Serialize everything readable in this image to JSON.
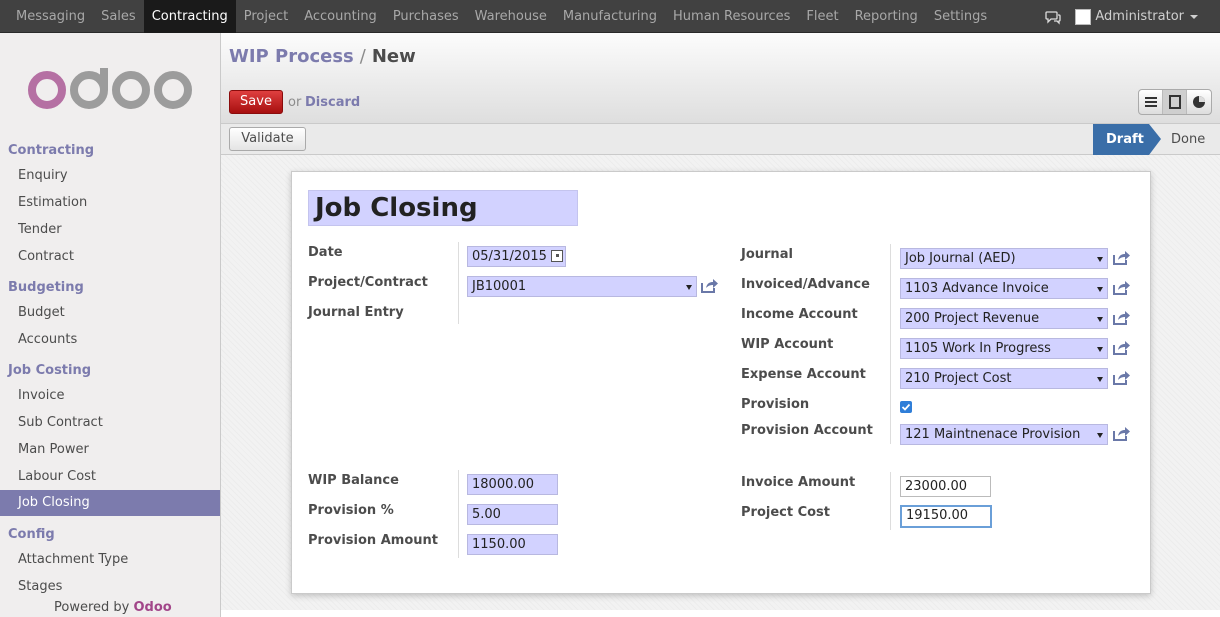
{
  "topmenu": [
    "Messaging",
    "Sales",
    "Contracting",
    "Project",
    "Accounting",
    "Purchases",
    "Warehouse",
    "Manufacturing",
    "Human Resources",
    "Fleet",
    "Reporting",
    "Settings"
  ],
  "user": {
    "name": "Administrator"
  },
  "logo": {
    "text": "odoo"
  },
  "sidebar": {
    "sections": [
      {
        "title": "Contracting",
        "items": [
          "Enquiry",
          "Estimation",
          "Tender",
          "Contract"
        ]
      },
      {
        "title": "Budgeting",
        "items": [
          "Budget",
          "Accounts"
        ]
      },
      {
        "title": "Job Costing",
        "items": [
          "Invoice",
          "Sub Contract",
          "Man Power",
          "Labour Cost",
          "Job Closing"
        ]
      },
      {
        "title": "Config",
        "items": [
          "Attachment Type",
          "Stages"
        ]
      }
    ],
    "active_item": "Job Closing",
    "powered_by": {
      "prefix": "Powered by",
      "brand": "Odoo"
    }
  },
  "breadcrumb": {
    "parent": "WIP Process",
    "separator": "/",
    "current": "New"
  },
  "buttons": {
    "save": "Save",
    "or": "or",
    "discard": "Discard",
    "validate": "Validate"
  },
  "statusbar": {
    "states": [
      "Draft",
      "Done"
    ],
    "active": "Draft"
  },
  "form": {
    "title": "Job Closing",
    "left": [
      {
        "label": "Date",
        "value": "05/31/2015",
        "kind": "date"
      },
      {
        "label": "Project/Contract",
        "value": "JB10001",
        "kind": "select"
      },
      {
        "label": "Journal Entry",
        "value": "",
        "kind": "empty"
      }
    ],
    "right": [
      {
        "label": "Journal",
        "value": "Job Journal (AED)"
      },
      {
        "label": "Invoiced/Advance",
        "value": "1103 Advance Invoice"
      },
      {
        "label": "Income Account",
        "value": "200 Project Revenue"
      },
      {
        "label": "WIP Account",
        "value": "1105 Work In Progress"
      },
      {
        "label": "Expense Account",
        "value": "210 Project Cost"
      },
      {
        "label": "Provision",
        "value": true,
        "kind": "checkbox"
      },
      {
        "label": "Provision Account",
        "value": "121 Maintnenace Provision"
      }
    ],
    "left_bottom": [
      {
        "label": "WIP Balance",
        "value": "18000.00"
      },
      {
        "label": "Provision %",
        "value": "5.00"
      },
      {
        "label": "Provision Amount",
        "value": "1150.00"
      }
    ],
    "right_bottom": [
      {
        "label": "Invoice Amount",
        "value": "23000.00"
      },
      {
        "label": "Project Cost",
        "value": "19150.00"
      }
    ]
  },
  "colors": {
    "brand": "#7c7bad",
    "save": "#c81616",
    "status_active": "#3a6ea8",
    "required_field": "#d2d2ff",
    "odoo_logo": "#a24689"
  }
}
